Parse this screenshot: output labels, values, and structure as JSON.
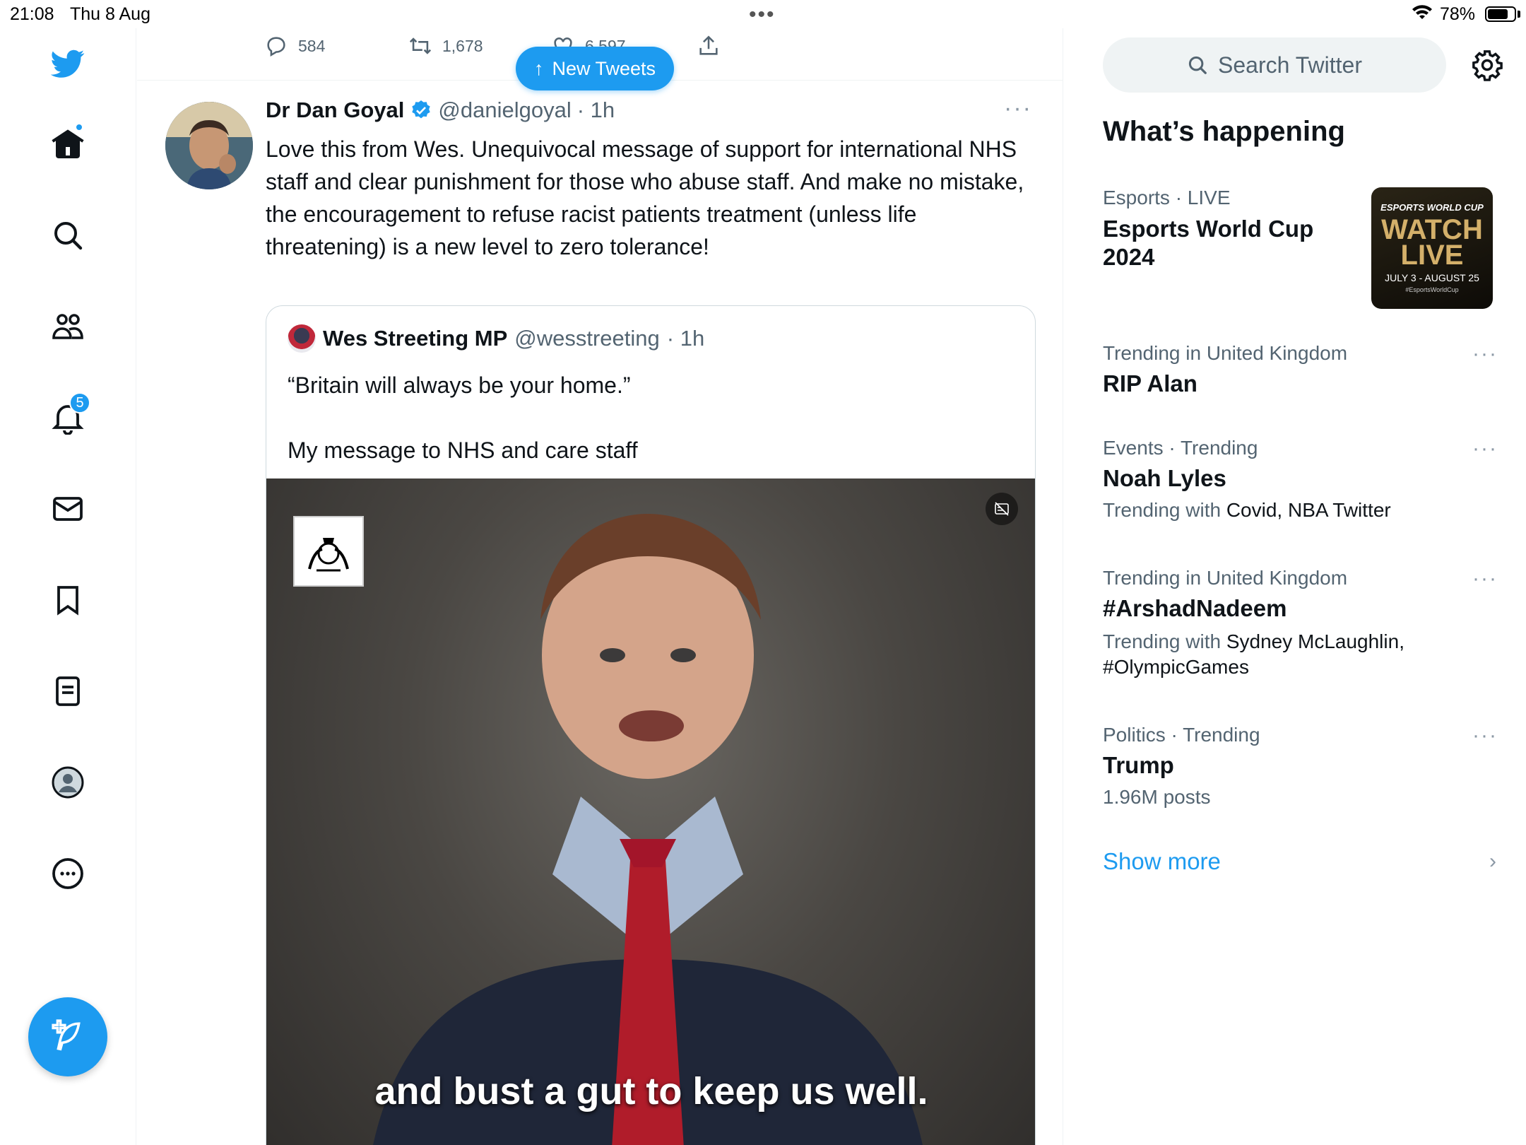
{
  "status_bar": {
    "time": "21:08",
    "date": "Thu 8 Aug",
    "wifi": "wifi-icon",
    "battery_pct": "78%",
    "battery_level": 0.78
  },
  "nav": {
    "notifications_badge": "5",
    "icons": [
      "twitter-bird-icon",
      "home-icon",
      "search-icon",
      "communities-icon",
      "bell-icon",
      "mail-icon",
      "bookmark-icon",
      "lists-icon",
      "profile-icon",
      "more-icon",
      "compose-icon"
    ]
  },
  "prev_tweet": {
    "replies": "584",
    "retweets": "1,678",
    "likes": "6,597"
  },
  "new_tweets_label": "New Tweets",
  "tweet": {
    "author": "Dr Dan Goyal",
    "handle": "@danielgoyal",
    "time": "· 1h",
    "text": "Love this from Wes. Unequivocal message of support for international NHS staff and clear punishment for those who abuse staff.  And make no mistake, the encouragement to refuse racist patients treatment (unless life threatening) is a new level to zero tolerance!",
    "more": "···",
    "quote": {
      "author": "Wes Streeting MP",
      "handle": "@wesstreeting",
      "time": "· 1h",
      "line1": "“Britain will always be your home.”",
      "line2": "My message to NHS and care staff",
      "caption": "and bust a gut to keep us well."
    }
  },
  "sidebar": {
    "search_placeholder": "Search Twitter",
    "section_title": "What’s happening",
    "esports": {
      "meta": "Esports · LIVE",
      "title": "Esports World Cup 2024",
      "image_top": "ESPORTS WORLD CUP",
      "image_watch": "WATCH LIVE",
      "image_dates": "JULY 3 - AUGUST 25",
      "image_tag": "#EsportsWorldCup"
    },
    "trends": [
      {
        "meta": "Trending in United Kingdom",
        "title": "RIP Alan",
        "sub_prefix": "",
        "sub": ""
      },
      {
        "meta": "Events · Trending",
        "title": "Noah Lyles",
        "sub_prefix": "Trending with",
        "sub": "Covid, NBA Twitter"
      },
      {
        "meta": "Trending in United Kingdom",
        "title": "#ArshadNadeem",
        "sub_prefix": "Trending with",
        "sub": "Sydney McLaughlin, #OlympicGames"
      },
      {
        "meta": "Politics · Trending",
        "title": "Trump",
        "sub_prefix": "",
        "sub": "1.96M posts"
      }
    ],
    "trend_more": "···",
    "show_more": "Show more"
  },
  "colors": {
    "accent": "#1d9bf0",
    "text": "#0f1419",
    "muted": "#536471"
  }
}
